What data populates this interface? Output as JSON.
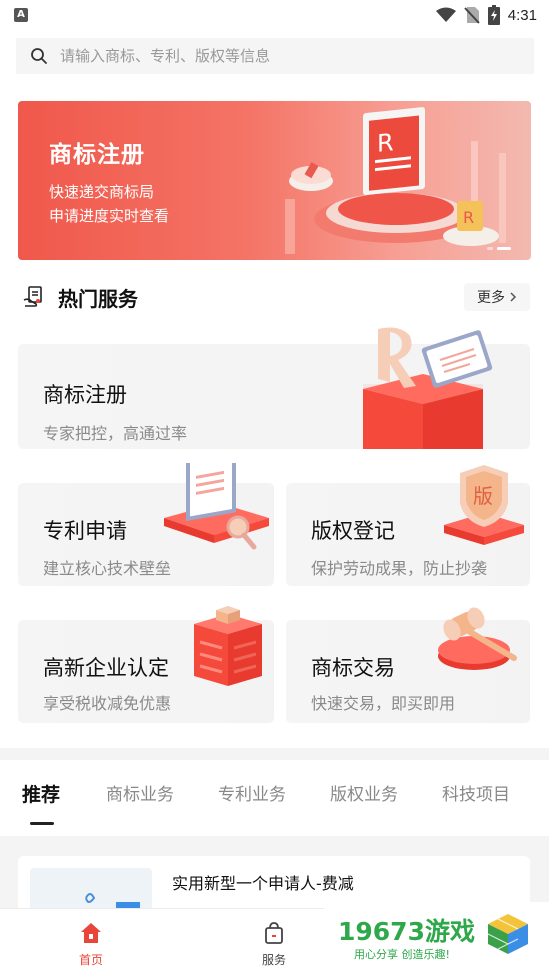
{
  "status_bar": {
    "left_badge": "A",
    "time": "4:31"
  },
  "search": {
    "placeholder": "请输入商标、专利、版权等信息"
  },
  "banner": {
    "title": "商标注册",
    "line1": "快速递交商标局",
    "line2": "申请进度实时查看",
    "page_count": 2,
    "active_page": 2
  },
  "hot_services": {
    "title": "热门服务",
    "more_label": "更多",
    "cards": [
      {
        "title": "商标注册",
        "subtitle": "专家把控，高通过率"
      },
      {
        "title": "专利申请",
        "subtitle": "建立核心技术壁垒"
      },
      {
        "title": "版权登记",
        "subtitle": "保护劳动成果，防止抄袭"
      },
      {
        "title": "高新企业认定",
        "subtitle": "享受税收减免优惠"
      },
      {
        "title": "商标交易",
        "subtitle": "快速交易，即买即用"
      }
    ]
  },
  "tabs": [
    {
      "label": "推荐",
      "active": true
    },
    {
      "label": "商标业务",
      "active": false
    },
    {
      "label": "专利业务",
      "active": false
    },
    {
      "label": "版权业务",
      "active": false
    },
    {
      "label": "科技项目",
      "active": false
    }
  ],
  "recommend_list": [
    {
      "title": "实用新型一个申请人-费减"
    }
  ],
  "bottom_nav": [
    {
      "label": "首页",
      "icon": "home-icon",
      "active": true
    },
    {
      "label": "服务",
      "icon": "bag-icon",
      "active": false
    }
  ],
  "watermark": {
    "text": "19673游戏",
    "sub": "用心分享 创造乐趣!"
  },
  "colors": {
    "accent": "#e8463a",
    "banner_start": "#f0584b",
    "card_bg": "#f5f5f5",
    "watermark_green": "#2ea84a"
  }
}
